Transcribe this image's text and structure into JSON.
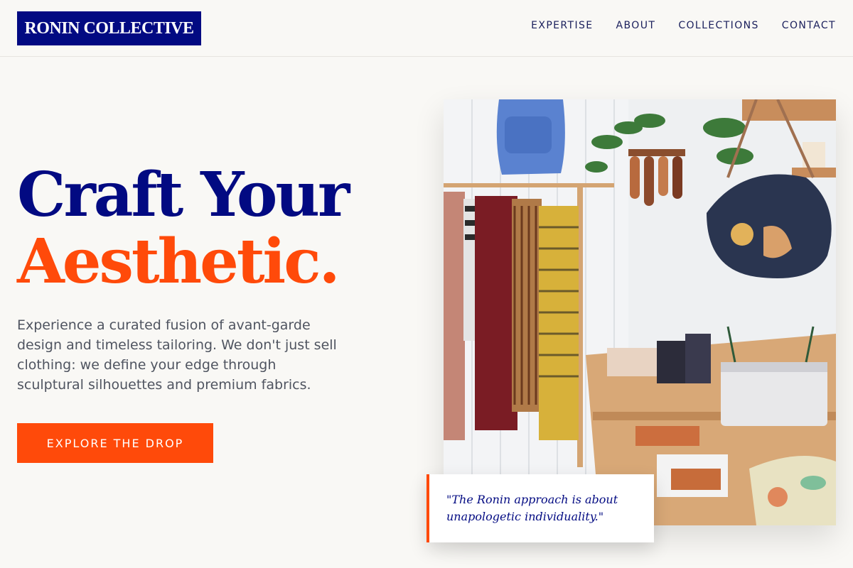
{
  "brand": {
    "name": "RONIN COLLECTIVE"
  },
  "nav": {
    "items": [
      {
        "label": "EXPERTISE"
      },
      {
        "label": "ABOUT"
      },
      {
        "label": "COLLECTIONS"
      },
      {
        "label": "CONTACT"
      }
    ]
  },
  "hero": {
    "headline_line1": "Craft Your",
    "headline_line2": "Aesthetic.",
    "description": "Experience a curated fusion of avant-garde design and timeless tailoring. We don't just sell clothing: we define your edge through sculptural silhouettes and premium fabrics.",
    "cta_label": "EXPLORE THE DROP"
  },
  "quote": {
    "text": "\"The Ronin approach is about unapologetic individuality.\""
  },
  "colors": {
    "brand_navy": "#020a82",
    "accent_orange": "#ff4a0a",
    "background": "#f9f8f5"
  }
}
